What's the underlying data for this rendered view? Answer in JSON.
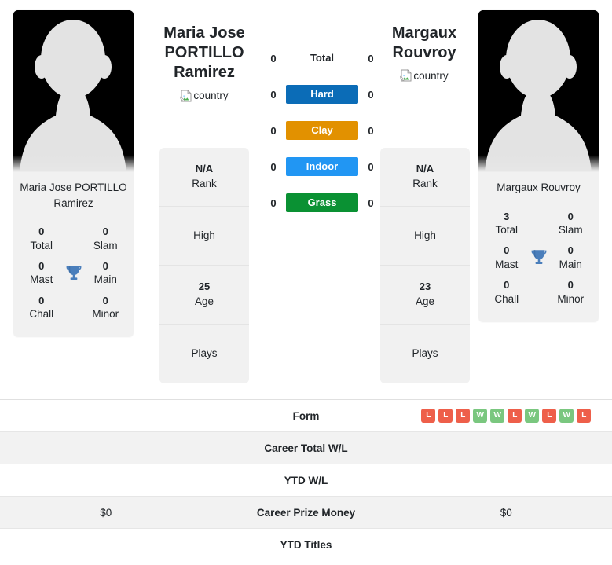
{
  "players": {
    "left": {
      "display_name_lines": [
        "Maria Jose",
        "PORTILLO",
        "Ramirez"
      ],
      "card_name": "Maria Jose PORTILLO Ramirez",
      "country_alt": "country",
      "photo_alt": "player-photo",
      "info": [
        {
          "value": "N/A",
          "label": "Rank"
        },
        {
          "value": "",
          "label": "High"
        },
        {
          "value": "25",
          "label": "Age"
        },
        {
          "value": "",
          "label": "Plays"
        }
      ],
      "titles": {
        "total": "0",
        "slam": "0",
        "mast": "0",
        "main": "0",
        "chall": "0",
        "minor": "0"
      },
      "prize_money": "$0"
    },
    "right": {
      "display_name_lines": [
        "Margaux",
        "Rouvroy"
      ],
      "card_name": "Margaux Rouvroy",
      "country_alt": "country",
      "photo_alt": "player-photo",
      "info": [
        {
          "value": "N/A",
          "label": "Rank"
        },
        {
          "value": "",
          "label": "High"
        },
        {
          "value": "23",
          "label": "Age"
        },
        {
          "value": "",
          "label": "Plays"
        }
      ],
      "titles": {
        "total": "3",
        "slam": "0",
        "mast": "0",
        "main": "0",
        "chall": "0",
        "minor": "0"
      },
      "prize_money": "$0"
    }
  },
  "titles_labels": {
    "total": "Total",
    "slam": "Slam",
    "mast": "Mast",
    "main": "Main",
    "chall": "Chall",
    "minor": "Minor"
  },
  "surfaces": [
    {
      "label": "Total",
      "left": "0",
      "right": "0",
      "color": "",
      "plain": true
    },
    {
      "label": "Hard",
      "left": "0",
      "right": "0",
      "color": "#0b6cb7",
      "plain": false
    },
    {
      "label": "Clay",
      "left": "0",
      "right": "0",
      "color": "#e29100",
      "plain": false
    },
    {
      "label": "Indoor",
      "left": "0",
      "right": "0",
      "color": "#2196f3",
      "plain": false
    },
    {
      "label": "Grass",
      "left": "0",
      "right": "0",
      "color": "#0a9133",
      "plain": false
    }
  ],
  "table": [
    {
      "label": "Form",
      "shaded": false,
      "left_text": "",
      "right_form": [
        "L",
        "L",
        "L",
        "W",
        "W",
        "L",
        "W",
        "L",
        "W",
        "L"
      ]
    },
    {
      "label": "Career Total W/L",
      "shaded": true,
      "left_text": "",
      "right_text": ""
    },
    {
      "label": "YTD W/L",
      "shaded": false,
      "left_text": "",
      "right_text": ""
    },
    {
      "label": "Career Prize Money",
      "shaded": true,
      "left_text": "$0",
      "right_text": "$0"
    },
    {
      "label": "YTD Titles",
      "shaded": false,
      "left_text": "",
      "right_text": ""
    }
  ],
  "colors": {
    "win": "#7ac77f",
    "loss": "#ee5f4a",
    "trophy": "#4a7ebb",
    "card_bg": "#f1f1f1",
    "row_shade": "#f2f2f2"
  },
  "icons": {
    "trophy": "trophy-icon",
    "broken_image": "broken-image-icon"
  }
}
